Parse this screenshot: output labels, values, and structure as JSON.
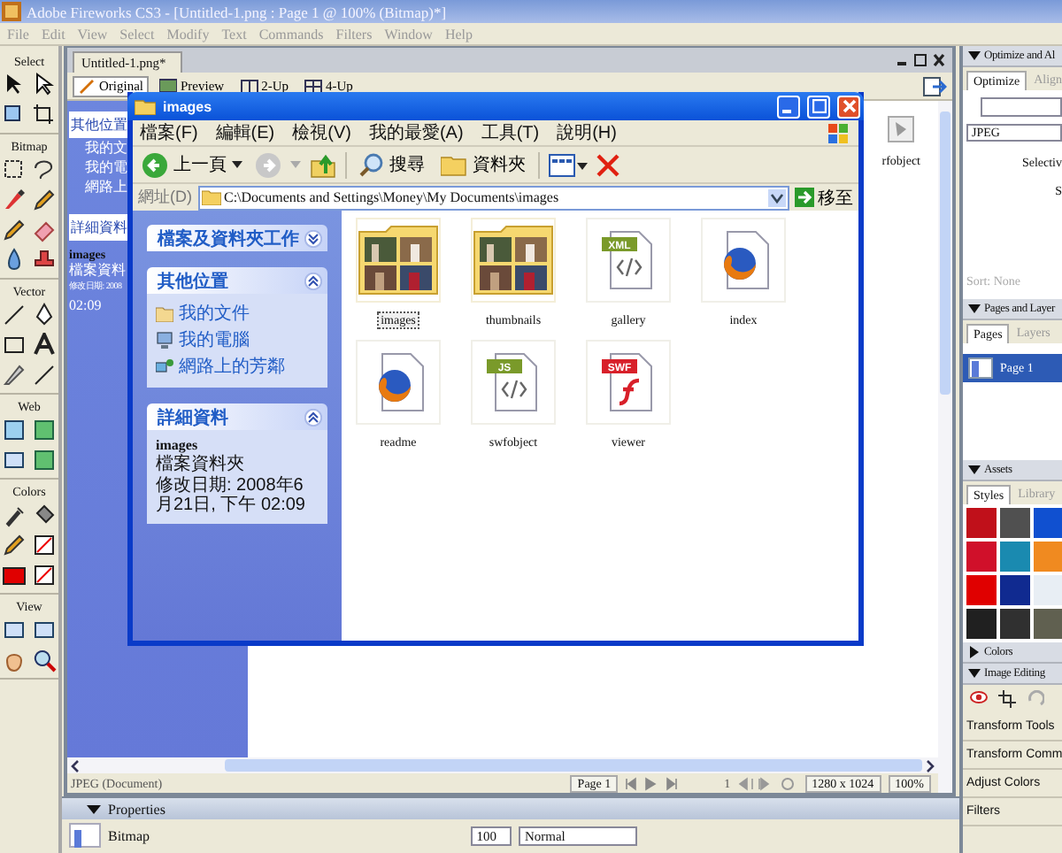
{
  "window": {
    "title": "Adobe Fireworks CS3 - [Untitled-1.png : Page 1 @ 100% (Bitmap)*]"
  },
  "menu": [
    "File",
    "Edit",
    "View",
    "Select",
    "Modify",
    "Text",
    "Commands",
    "Filters",
    "Window",
    "Help"
  ],
  "tools": {
    "sections": [
      "Select",
      "Bitmap",
      "Vector",
      "Web",
      "Colors",
      "View"
    ]
  },
  "document": {
    "tab": "Untitled-1.png*",
    "views": [
      {
        "label": "Original",
        "selected": true
      },
      {
        "label": "Preview",
        "selected": false
      },
      {
        "label": "2-Up",
        "selected": false
      },
      {
        "label": "4-Up",
        "selected": false
      }
    ],
    "canvas": {
      "places_title": "其他位置",
      "places": [
        "我的文",
        "我的電",
        "網路上"
      ],
      "details_title": "詳細資料",
      "name": "images",
      "type": "檔案資料",
      "modified": "修改日期: 2008",
      "time": "02:09",
      "file_label": "rfobject"
    },
    "status": {
      "format": "JPEG (Document)",
      "page": "Page 1",
      "frame": "1",
      "size": "1280 x 1024",
      "zoom": "100%"
    }
  },
  "properties": {
    "title": "Properties",
    "expanded": true,
    "object": "Bitmap",
    "opacity": "100",
    "blend": "Normal"
  },
  "explorer": {
    "title": "images",
    "menu": [
      "檔案(F)",
      "編輯(E)",
      "檢視(V)",
      "我的最愛(A)",
      "工具(T)",
      "說明(H)"
    ],
    "back": "上一頁",
    "search": "搜尋",
    "folders": "資料夾",
    "address_label": "網址(D)",
    "address": "C:\\Documents and Settings\\Money\\My Documents\\images",
    "go": "移至",
    "panels": [
      {
        "title": "檔案及資料夾工作",
        "expanded": false
      },
      {
        "title": "其他位置",
        "expanded": true,
        "links": [
          "我的文件",
          "我的電腦",
          "網路上的芳鄰"
        ]
      },
      {
        "title": "詳細資料",
        "expanded": true,
        "name": "images",
        "type": "檔案資料夾",
        "modified": "修改日期: 2008年6月21日, 下午 02:09"
      }
    ],
    "files": [
      {
        "name": "images",
        "kind": "photo-folder",
        "selected": true
      },
      {
        "name": "thumbnails",
        "kind": "photo-folder",
        "selected": false
      },
      {
        "name": "gallery",
        "kind": "script",
        "badge": "XML",
        "color": "#7a9a2a",
        "selected": false
      },
      {
        "name": "index",
        "kind": "browser",
        "selected": false
      },
      {
        "name": "readme",
        "kind": "browser",
        "selected": false
      },
      {
        "name": "swfobject",
        "kind": "script",
        "badge": "JS",
        "color": "#7a9a2a",
        "selected": false
      },
      {
        "name": "viewer",
        "kind": "flash",
        "badge": "SWF",
        "color": "#d8202a",
        "selected": false
      }
    ]
  },
  "right_panel": {
    "optimize": {
      "title": "Optimize and Al",
      "expanded": true,
      "tabs": [
        {
          "label": "Optimize",
          "selected": true
        },
        {
          "label": "Align",
          "selected": false
        }
      ],
      "format": "JPEG",
      "label_1": "Selectiv",
      "label_2": "S",
      "sort": "Sort: None"
    },
    "pages": {
      "title": "Pages and Layer",
      "expanded": true,
      "tabs": [
        {
          "label": "Pages",
          "selected": true
        },
        {
          "label": "Layers",
          "selected": false
        }
      ],
      "items": [
        {
          "label": "Page 1",
          "selected": true
        }
      ]
    },
    "assets": {
      "title": "Assets",
      "expanded": true,
      "tabs": [
        {
          "label": "Styles",
          "selected": true
        },
        {
          "label": "Library",
          "selected": false
        }
      ],
      "swatches": [
        {
          "color": "#c0101a"
        },
        {
          "color": "#505050"
        },
        {
          "color": "#1050d0"
        },
        {
          "color": "#d0102a"
        },
        {
          "color": "#1a8ab0"
        },
        {
          "color": "#f08a20"
        },
        {
          "color": "#e00000"
        },
        {
          "color": "#102a90"
        },
        {
          "color": "#e8eef4"
        },
        {
          "color": "#202020"
        },
        {
          "color": "#303030"
        },
        {
          "color": "#606050"
        }
      ]
    },
    "colors": {
      "title": "Colors",
      "expanded": false
    },
    "image_editing": {
      "title": "Image Editing",
      "expanded": true,
      "items": [
        "Transform Tools",
        "Transform Comm",
        "Adjust Colors",
        "Filters"
      ]
    }
  }
}
